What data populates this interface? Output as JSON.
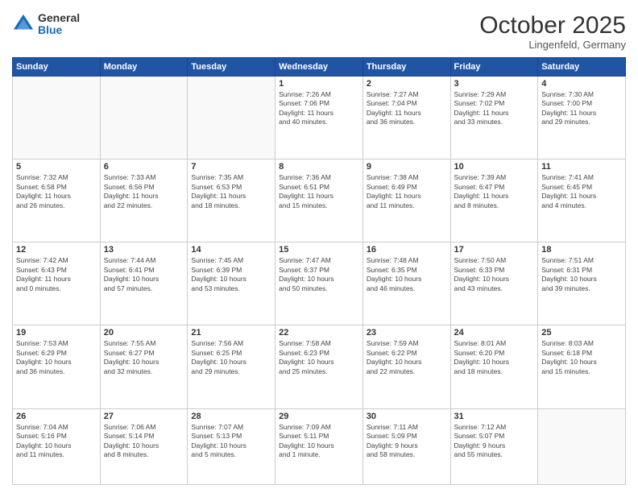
{
  "logo": {
    "general": "General",
    "blue": "Blue"
  },
  "header": {
    "month": "October 2025",
    "location": "Lingenfeld, Germany"
  },
  "weekdays": [
    "Sunday",
    "Monday",
    "Tuesday",
    "Wednesday",
    "Thursday",
    "Friday",
    "Saturday"
  ],
  "weeks": [
    [
      {
        "day": "",
        "info": ""
      },
      {
        "day": "",
        "info": ""
      },
      {
        "day": "",
        "info": ""
      },
      {
        "day": "1",
        "info": "Sunrise: 7:26 AM\nSunset: 7:06 PM\nDaylight: 11 hours\nand 40 minutes."
      },
      {
        "day": "2",
        "info": "Sunrise: 7:27 AM\nSunset: 7:04 PM\nDaylight: 11 hours\nand 36 minutes."
      },
      {
        "day": "3",
        "info": "Sunrise: 7:29 AM\nSunset: 7:02 PM\nDaylight: 11 hours\nand 33 minutes."
      },
      {
        "day": "4",
        "info": "Sunrise: 7:30 AM\nSunset: 7:00 PM\nDaylight: 11 hours\nand 29 minutes."
      }
    ],
    [
      {
        "day": "5",
        "info": "Sunrise: 7:32 AM\nSunset: 6:58 PM\nDaylight: 11 hours\nand 26 minutes."
      },
      {
        "day": "6",
        "info": "Sunrise: 7:33 AM\nSunset: 6:56 PM\nDaylight: 11 hours\nand 22 minutes."
      },
      {
        "day": "7",
        "info": "Sunrise: 7:35 AM\nSunset: 6:53 PM\nDaylight: 11 hours\nand 18 minutes."
      },
      {
        "day": "8",
        "info": "Sunrise: 7:36 AM\nSunset: 6:51 PM\nDaylight: 11 hours\nand 15 minutes."
      },
      {
        "day": "9",
        "info": "Sunrise: 7:38 AM\nSunset: 6:49 PM\nDaylight: 11 hours\nand 11 minutes."
      },
      {
        "day": "10",
        "info": "Sunrise: 7:39 AM\nSunset: 6:47 PM\nDaylight: 11 hours\nand 8 minutes."
      },
      {
        "day": "11",
        "info": "Sunrise: 7:41 AM\nSunset: 6:45 PM\nDaylight: 11 hours\nand 4 minutes."
      }
    ],
    [
      {
        "day": "12",
        "info": "Sunrise: 7:42 AM\nSunset: 6:43 PM\nDaylight: 11 hours\nand 0 minutes."
      },
      {
        "day": "13",
        "info": "Sunrise: 7:44 AM\nSunset: 6:41 PM\nDaylight: 10 hours\nand 57 minutes."
      },
      {
        "day": "14",
        "info": "Sunrise: 7:45 AM\nSunset: 6:39 PM\nDaylight: 10 hours\nand 53 minutes."
      },
      {
        "day": "15",
        "info": "Sunrise: 7:47 AM\nSunset: 6:37 PM\nDaylight: 10 hours\nand 50 minutes."
      },
      {
        "day": "16",
        "info": "Sunrise: 7:48 AM\nSunset: 6:35 PM\nDaylight: 10 hours\nand 46 minutes."
      },
      {
        "day": "17",
        "info": "Sunrise: 7:50 AM\nSunset: 6:33 PM\nDaylight: 10 hours\nand 43 minutes."
      },
      {
        "day": "18",
        "info": "Sunrise: 7:51 AM\nSunset: 6:31 PM\nDaylight: 10 hours\nand 39 minutes."
      }
    ],
    [
      {
        "day": "19",
        "info": "Sunrise: 7:53 AM\nSunset: 6:29 PM\nDaylight: 10 hours\nand 36 minutes."
      },
      {
        "day": "20",
        "info": "Sunrise: 7:55 AM\nSunset: 6:27 PM\nDaylight: 10 hours\nand 32 minutes."
      },
      {
        "day": "21",
        "info": "Sunrise: 7:56 AM\nSunset: 6:25 PM\nDaylight: 10 hours\nand 29 minutes."
      },
      {
        "day": "22",
        "info": "Sunrise: 7:58 AM\nSunset: 6:23 PM\nDaylight: 10 hours\nand 25 minutes."
      },
      {
        "day": "23",
        "info": "Sunrise: 7:59 AM\nSunset: 6:22 PM\nDaylight: 10 hours\nand 22 minutes."
      },
      {
        "day": "24",
        "info": "Sunrise: 8:01 AM\nSunset: 6:20 PM\nDaylight: 10 hours\nand 18 minutes."
      },
      {
        "day": "25",
        "info": "Sunrise: 8:03 AM\nSunset: 6:18 PM\nDaylight: 10 hours\nand 15 minutes."
      }
    ],
    [
      {
        "day": "26",
        "info": "Sunrise: 7:04 AM\nSunset: 5:16 PM\nDaylight: 10 hours\nand 11 minutes."
      },
      {
        "day": "27",
        "info": "Sunrise: 7:06 AM\nSunset: 5:14 PM\nDaylight: 10 hours\nand 8 minutes."
      },
      {
        "day": "28",
        "info": "Sunrise: 7:07 AM\nSunset: 5:13 PM\nDaylight: 10 hours\nand 5 minutes."
      },
      {
        "day": "29",
        "info": "Sunrise: 7:09 AM\nSunset: 5:11 PM\nDaylight: 10 hours\nand 1 minute."
      },
      {
        "day": "30",
        "info": "Sunrise: 7:11 AM\nSunset: 5:09 PM\nDaylight: 9 hours\nand 58 minutes."
      },
      {
        "day": "31",
        "info": "Sunrise: 7:12 AM\nSunset: 5:07 PM\nDaylight: 9 hours\nand 55 minutes."
      },
      {
        "day": "",
        "info": ""
      }
    ]
  ]
}
